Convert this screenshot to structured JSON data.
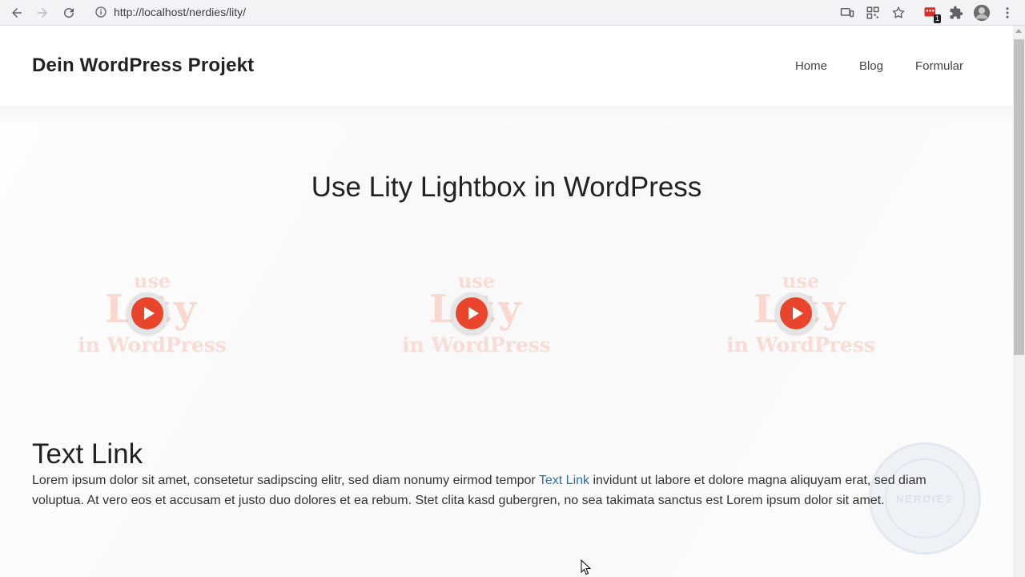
{
  "browser": {
    "url": "http://localhost/nerdies/lity/",
    "extension_badge": "1"
  },
  "site": {
    "title": "Dein WordPress Projekt",
    "nav": [
      "Home",
      "Blog",
      "Formular"
    ]
  },
  "page": {
    "heading": "Use Lity Lightbox in WordPress",
    "videos": [
      {
        "wm_top": "use",
        "wm_mid": "Lity",
        "wm_bot": "in WordPress"
      },
      {
        "wm_top": "use",
        "wm_mid": "Lity",
        "wm_bot": "in WordPress"
      },
      {
        "wm_top": "use",
        "wm_mid": "Lity",
        "wm_bot": "in WordPress"
      }
    ],
    "section_heading": "Text Link",
    "paragraph_before": "Lorem ipsum dolor sit amet, consetetur sadipscing elitr, sed diam nonumy eirmod tempor ",
    "paragraph_link": "Text Link",
    "paragraph_after": " invidunt ut labore et dolore magna aliquyam erat, sed diam voluptua. At vero eos et accusam et justo duo dolores et ea rebum. Stet clita kasd gubergren, no sea takimata sanctus est Lorem ipsum dolor sit amet.",
    "seal_text": "NERDIES"
  },
  "colors": {
    "link": "#2f6fab",
    "play_red": "#e8452c",
    "chrome_bg": "#f1f3f4"
  }
}
